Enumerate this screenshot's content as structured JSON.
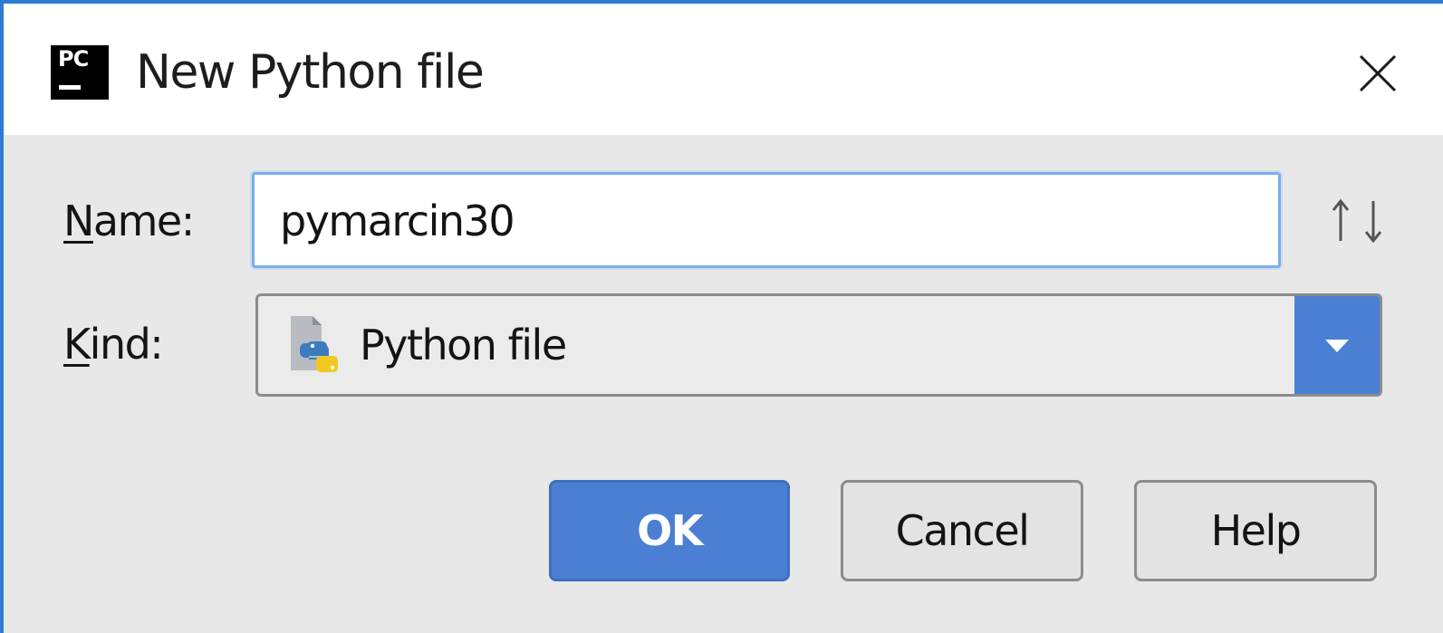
{
  "dialog": {
    "title": "New Python file",
    "app_icon": {
      "name": "pycharm-icon",
      "text": "PC"
    },
    "close_icon": "close-icon"
  },
  "form": {
    "name": {
      "label_mnemonic": "N",
      "label_rest": "ame:",
      "value": "pymarcin30"
    },
    "kind": {
      "label_mnemonic": "K",
      "label_rest": "ind:",
      "selected": "Python file",
      "icon": "python-file-icon"
    },
    "sort_icon": "sort-up-down-icon"
  },
  "buttons": {
    "ok": "OK",
    "cancel": "Cancel",
    "help": "Help"
  },
  "colors": {
    "accent": "#4a7fd4",
    "window_border": "#2e7bd2",
    "background": "#e8e8e8"
  }
}
